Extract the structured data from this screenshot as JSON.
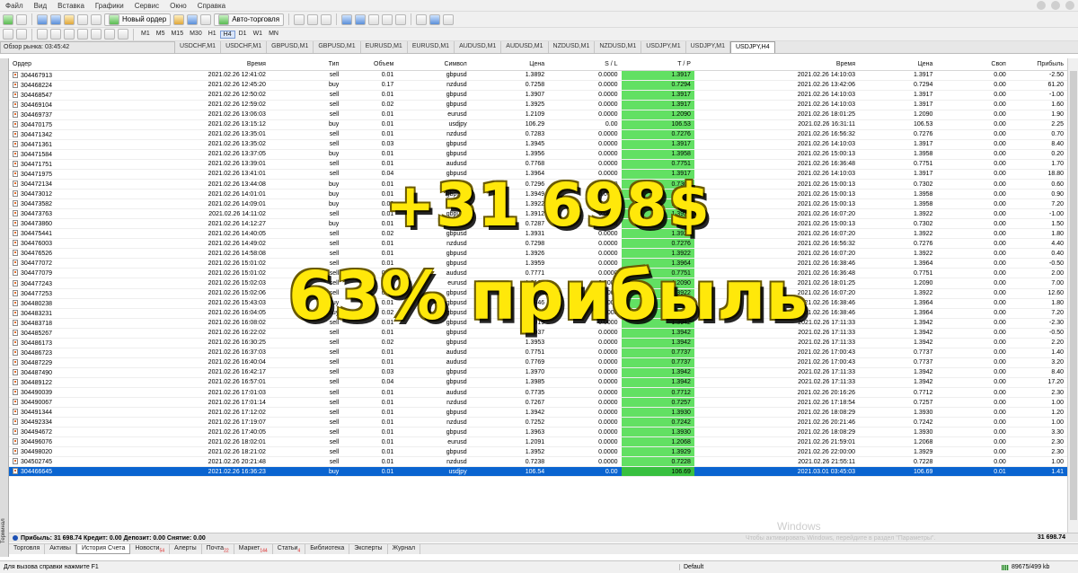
{
  "menu": [
    "Файл",
    "Вид",
    "Вставка",
    "Графики",
    "Сервис",
    "Окно",
    "Справка"
  ],
  "toolbar": {
    "new_order": "Новый ордер",
    "auto_trading": "Авто-торговля"
  },
  "timeframes": [
    "M1",
    "M5",
    "M15",
    "M30",
    "H1",
    "H4",
    "D1",
    "W1",
    "MN"
  ],
  "active_timeframe": "H4",
  "market_watch": {
    "title": "Обзор рынка: 03:45:42"
  },
  "chart_tabs": [
    "USDCHF,M1",
    "USDCHF,M1",
    "GBPUSD,M1",
    "GBPUSD,M1",
    "EURUSD,M1",
    "EURUSD,M1",
    "AUDUSD,M1",
    "AUDUSD,M1",
    "NZDUSD,M1",
    "NZDUSD,M1",
    "USDJPY,M1",
    "USDJPY,M1",
    "USDJPY,H4"
  ],
  "active_chart_tab": "USDJPY,H4",
  "table": {
    "headers": {
      "order": "Ордер",
      "time": "Время",
      "type": "Тип",
      "volume": "Объем",
      "symbol": "Символ",
      "price": "Цена",
      "sl": "S / L",
      "tp": "T / P",
      "close_time": "Время",
      "close_price": "Цена",
      "swap": "Своп",
      "profit": "Прибыль"
    },
    "rows": [
      [
        "304467913",
        "2021.02.26 12:41:02",
        "sell",
        "0.01",
        "gbpusd",
        "1.3892",
        "0.0000",
        "1.3917",
        "2021.02.26 14:10:03",
        "1.3917",
        "0.00",
        "-2.50"
      ],
      [
        "304468224",
        "2021.02.26 12:45:20",
        "buy",
        "0.17",
        "nzdusd",
        "0.7258",
        "0.0000",
        "0.7294",
        "2021.02.26 13:42:06",
        "0.7294",
        "0.00",
        "61.20"
      ],
      [
        "304468547",
        "2021.02.26 12:50:02",
        "sell",
        "0.01",
        "gbpusd",
        "1.3907",
        "0.0000",
        "1.3917",
        "2021.02.26 14:10:03",
        "1.3917",
        "0.00",
        "-1.00"
      ],
      [
        "304469104",
        "2021.02.26 12:59:02",
        "sell",
        "0.02",
        "gbpusd",
        "1.3925",
        "0.0000",
        "1.3917",
        "2021.02.26 14:10:03",
        "1.3917",
        "0.00",
        "1.60"
      ],
      [
        "304469737",
        "2021.02.26 13:06:03",
        "sell",
        "0.01",
        "eurusd",
        "1.2109",
        "0.0000",
        "1.2090",
        "2021.02.26 18:01:25",
        "1.2090",
        "0.00",
        "1.90"
      ],
      [
        "304470175",
        "2021.02.26 13:15:12",
        "buy",
        "0.01",
        "usdjpy",
        "106.29",
        "0.00",
        "106.53",
        "2021.02.26 16:31:11",
        "106.53",
        "0.00",
        "2.25"
      ],
      [
        "304471342",
        "2021.02.26 13:35:01",
        "sell",
        "0.01",
        "nzdusd",
        "0.7283",
        "0.0000",
        "0.7276",
        "2021.02.26 16:56:32",
        "0.7276",
        "0.00",
        "0.70"
      ],
      [
        "304471361",
        "2021.02.26 13:35:02",
        "sell",
        "0.03",
        "gbpusd",
        "1.3945",
        "0.0000",
        "1.3917",
        "2021.02.26 14:10:03",
        "1.3917",
        "0.00",
        "8.40"
      ],
      [
        "304471584",
        "2021.02.26 13:37:05",
        "buy",
        "0.01",
        "gbpusd",
        "1.3956",
        "0.0000",
        "1.3958",
        "2021.02.26 15:00:13",
        "1.3958",
        "0.00",
        "0.20"
      ],
      [
        "304471751",
        "2021.02.26 13:39:01",
        "sell",
        "0.01",
        "audusd",
        "0.7768",
        "0.0000",
        "0.7751",
        "2021.02.26 16:36:48",
        "0.7751",
        "0.00",
        "1.70"
      ],
      [
        "304471975",
        "2021.02.26 13:41:01",
        "sell",
        "0.04",
        "gbpusd",
        "1.3964",
        "0.0000",
        "1.3917",
        "2021.02.26 14:10:03",
        "1.3917",
        "0.00",
        "18.80"
      ],
      [
        "304472134",
        "2021.02.26 13:44:08",
        "buy",
        "0.01",
        "nzdusd",
        "0.7296",
        "0.0000",
        "0.7302",
        "2021.02.26 15:00:13",
        "0.7302",
        "0.00",
        "0.60"
      ],
      [
        "304473012",
        "2021.02.26 14:01:01",
        "buy",
        "0.01",
        "gbpusd",
        "1.3949",
        "0.0000",
        "1.3958",
        "2021.02.26 15:00:13",
        "1.3958",
        "0.00",
        "0.90"
      ],
      [
        "304473582",
        "2021.02.26 14:09:01",
        "buy",
        "0.02",
        "gbpusd",
        "1.3922",
        "0.0000",
        "1.3958",
        "2021.02.26 15:00:13",
        "1.3958",
        "0.00",
        "7.20"
      ],
      [
        "304473763",
        "2021.02.26 14:11:02",
        "sell",
        "0.01",
        "gbpusd",
        "1.3912",
        "0.0000",
        "1.3922",
        "2021.02.26 16:07:20",
        "1.3922",
        "0.00",
        "-1.00"
      ],
      [
        "304473860",
        "2021.02.26 14:12:27",
        "buy",
        "0.01",
        "nzdusd",
        "0.7287",
        "0.0000",
        "0.7302",
        "2021.02.26 15:00:13",
        "0.7302",
        "0.00",
        "1.50"
      ],
      [
        "304475441",
        "2021.02.26 14:40:05",
        "sell",
        "0.02",
        "gbpusd",
        "1.3931",
        "0.0000",
        "1.3922",
        "2021.02.26 16:07:20",
        "1.3922",
        "0.00",
        "1.80"
      ],
      [
        "304476003",
        "2021.02.26 14:49:02",
        "sell",
        "0.01",
        "nzdusd",
        "0.7298",
        "0.0000",
        "0.7276",
        "2021.02.26 16:56:32",
        "0.7276",
        "0.00",
        "4.40"
      ],
      [
        "304476526",
        "2021.02.26 14:58:08",
        "sell",
        "0.01",
        "gbpusd",
        "1.3926",
        "0.0000",
        "1.3922",
        "2021.02.26 16:07:20",
        "1.3922",
        "0.00",
        "0.40"
      ],
      [
        "304477072",
        "2021.02.26 15:01:02",
        "sell",
        "0.01",
        "gbpusd",
        "1.3959",
        "0.0000",
        "1.3964",
        "2021.02.26 16:38:46",
        "1.3964",
        "0.00",
        "-0.50"
      ],
      [
        "304477079",
        "2021.02.26 15:01:02",
        "sell",
        "0.01",
        "audusd",
        "0.7771",
        "0.0000",
        "0.7751",
        "2021.02.26 16:36:48",
        "0.7751",
        "0.00",
        "2.00"
      ],
      [
        "304477243",
        "2021.02.26 15:02:03",
        "sell",
        "0.01",
        "eurusd",
        "1.2160",
        "0.0000",
        "1.2090",
        "2021.02.26 18:01:25",
        "1.2090",
        "0.00",
        "7.00"
      ],
      [
        "304477253",
        "2021.02.26 15:02:06",
        "sell",
        "0.03",
        "gbpusd",
        "1.3964",
        "0.0000",
        "1.3922",
        "2021.02.26 16:07:20",
        "1.3922",
        "0.00",
        "12.60"
      ],
      [
        "304480238",
        "2021.02.26 15:43:03",
        "buy",
        "0.01",
        "gbpusd",
        "1.3946",
        "0.0000",
        "1.3964",
        "2021.02.26 16:38:46",
        "1.3964",
        "0.00",
        "1.80"
      ],
      [
        "304483231",
        "2021.02.26 16:04:05",
        "buy",
        "0.02",
        "gbpusd",
        "1.3928",
        "0.0000",
        "1.3964",
        "2021.02.26 16:38:46",
        "1.3964",
        "0.00",
        "7.20"
      ],
      [
        "304483718",
        "2021.02.26 16:08:02",
        "sell",
        "0.01",
        "gbpusd",
        "1.3919",
        "0.0000",
        "1.3942",
        "2021.02.26 17:11:33",
        "1.3942",
        "0.00",
        "-2.30"
      ],
      [
        "304485267",
        "2021.02.26 16:22:02",
        "sell",
        "0.01",
        "gbpusd",
        "1.3937",
        "0.0000",
        "1.3942",
        "2021.02.26 17:11:33",
        "1.3942",
        "0.00",
        "-0.50"
      ],
      [
        "304486173",
        "2021.02.26 16:30:25",
        "sell",
        "0.02",
        "gbpusd",
        "1.3953",
        "0.0000",
        "1.3942",
        "2021.02.26 17:11:33",
        "1.3942",
        "0.00",
        "2.20"
      ],
      [
        "304486723",
        "2021.02.26 16:37:03",
        "sell",
        "0.01",
        "audusd",
        "0.7751",
        "0.0000",
        "0.7737",
        "2021.02.26 17:00:43",
        "0.7737",
        "0.00",
        "1.40"
      ],
      [
        "304487229",
        "2021.02.26 16:40:04",
        "sell",
        "0.01",
        "audusd",
        "0.7769",
        "0.0000",
        "0.7737",
        "2021.02.26 17:00:43",
        "0.7737",
        "0.00",
        "3.20"
      ],
      [
        "304487490",
        "2021.02.26 16:42:17",
        "sell",
        "0.03",
        "gbpusd",
        "1.3970",
        "0.0000",
        "1.3942",
        "2021.02.26 17:11:33",
        "1.3942",
        "0.00",
        "8.40"
      ],
      [
        "304489122",
        "2021.02.26 16:57:01",
        "sell",
        "0.04",
        "gbpusd",
        "1.3985",
        "0.0000",
        "1.3942",
        "2021.02.26 17:11:33",
        "1.3942",
        "0.00",
        "17.20"
      ],
      [
        "304490039",
        "2021.02.26 17:01:03",
        "sell",
        "0.01",
        "audusd",
        "0.7735",
        "0.0000",
        "0.7712",
        "2021.02.26 20:16:26",
        "0.7712",
        "0.00",
        "2.30"
      ],
      [
        "304490067",
        "2021.02.26 17:01:14",
        "sell",
        "0.01",
        "nzdusd",
        "0.7267",
        "0.0000",
        "0.7257",
        "2021.02.26 17:18:54",
        "0.7257",
        "0.00",
        "1.00"
      ],
      [
        "304491344",
        "2021.02.26 17:12:02",
        "sell",
        "0.01",
        "gbpusd",
        "1.3942",
        "0.0000",
        "1.3930",
        "2021.02.26 18:08:29",
        "1.3930",
        "0.00",
        "1.20"
      ],
      [
        "304492334",
        "2021.02.26 17:19:07",
        "sell",
        "0.01",
        "nzdusd",
        "0.7252",
        "0.0000",
        "0.7242",
        "2021.02.26 20:21:46",
        "0.7242",
        "0.00",
        "1.00"
      ],
      [
        "304494672",
        "2021.02.26 17:40:05",
        "sell",
        "0.01",
        "gbpusd",
        "1.3963",
        "0.0000",
        "1.3930",
        "2021.02.26 18:08:29",
        "1.3930",
        "0.00",
        "3.30"
      ],
      [
        "304496076",
        "2021.02.26 18:02:01",
        "sell",
        "0.01",
        "eurusd",
        "1.2091",
        "0.0000",
        "1.2068",
        "2021.02.26 21:59:01",
        "1.2068",
        "0.00",
        "2.30"
      ],
      [
        "304498020",
        "2021.02.26 18:21:02",
        "sell",
        "0.01",
        "gbpusd",
        "1.3952",
        "0.0000",
        "1.3929",
        "2021.02.26 22:00:00",
        "1.3929",
        "0.00",
        "2.30"
      ],
      [
        "304502745",
        "2021.02.26 20:21:48",
        "sell",
        "0.01",
        "nzdusd",
        "0.7238",
        "0.0000",
        "0.7228",
        "2021.02.26 21:55:11",
        "0.7228",
        "0.00",
        "1.00"
      ],
      [
        "304466645",
        "2021.02.26 16:36:23",
        "buy",
        "0.01",
        "usdjpy",
        "106.54",
        "0.00",
        "106.69",
        "2021.03.01 03:45:03",
        "106.69",
        "0.01",
        "1.41"
      ]
    ]
  },
  "summary": {
    "text": "Прибыль: 31 698.74  Кредит: 0.00  Депозит: 0.00  Снятие: 0.00",
    "total": "31 698.74"
  },
  "overlay": {
    "line1": "+31 698$",
    "line2": "63% прибыль"
  },
  "watermark": {
    "line1": "Windows",
    "line2": "Чтобы активировать Windows, перейдите в раздел \"Параметры\"."
  },
  "terminal_label": "Терминал",
  "bottom_tabs": [
    {
      "label": "Торговля",
      "badge": ""
    },
    {
      "label": "Активы",
      "badge": ""
    },
    {
      "label": "История Счета",
      "badge": ""
    },
    {
      "label": "Новости",
      "badge": "54"
    },
    {
      "label": "Алерты",
      "badge": ""
    },
    {
      "label": "Почта",
      "badge": "22"
    },
    {
      "label": "Маркет",
      "badge": "144"
    },
    {
      "label": "Статьи",
      "badge": "4"
    },
    {
      "label": "Библиотека",
      "badge": ""
    },
    {
      "label": "Эксперты",
      "badge": ""
    },
    {
      "label": "Журнал",
      "badge": ""
    }
  ],
  "active_bottom_tab": "История Счета",
  "status": {
    "help": "Для вызова справки нажмите F1",
    "profile": "Default",
    "traffic": "89675/499 kb"
  },
  "colors": {
    "tp_column": "#62e063",
    "selected_row": "#0a64d0",
    "overlay_text": "#ffe80a"
  }
}
